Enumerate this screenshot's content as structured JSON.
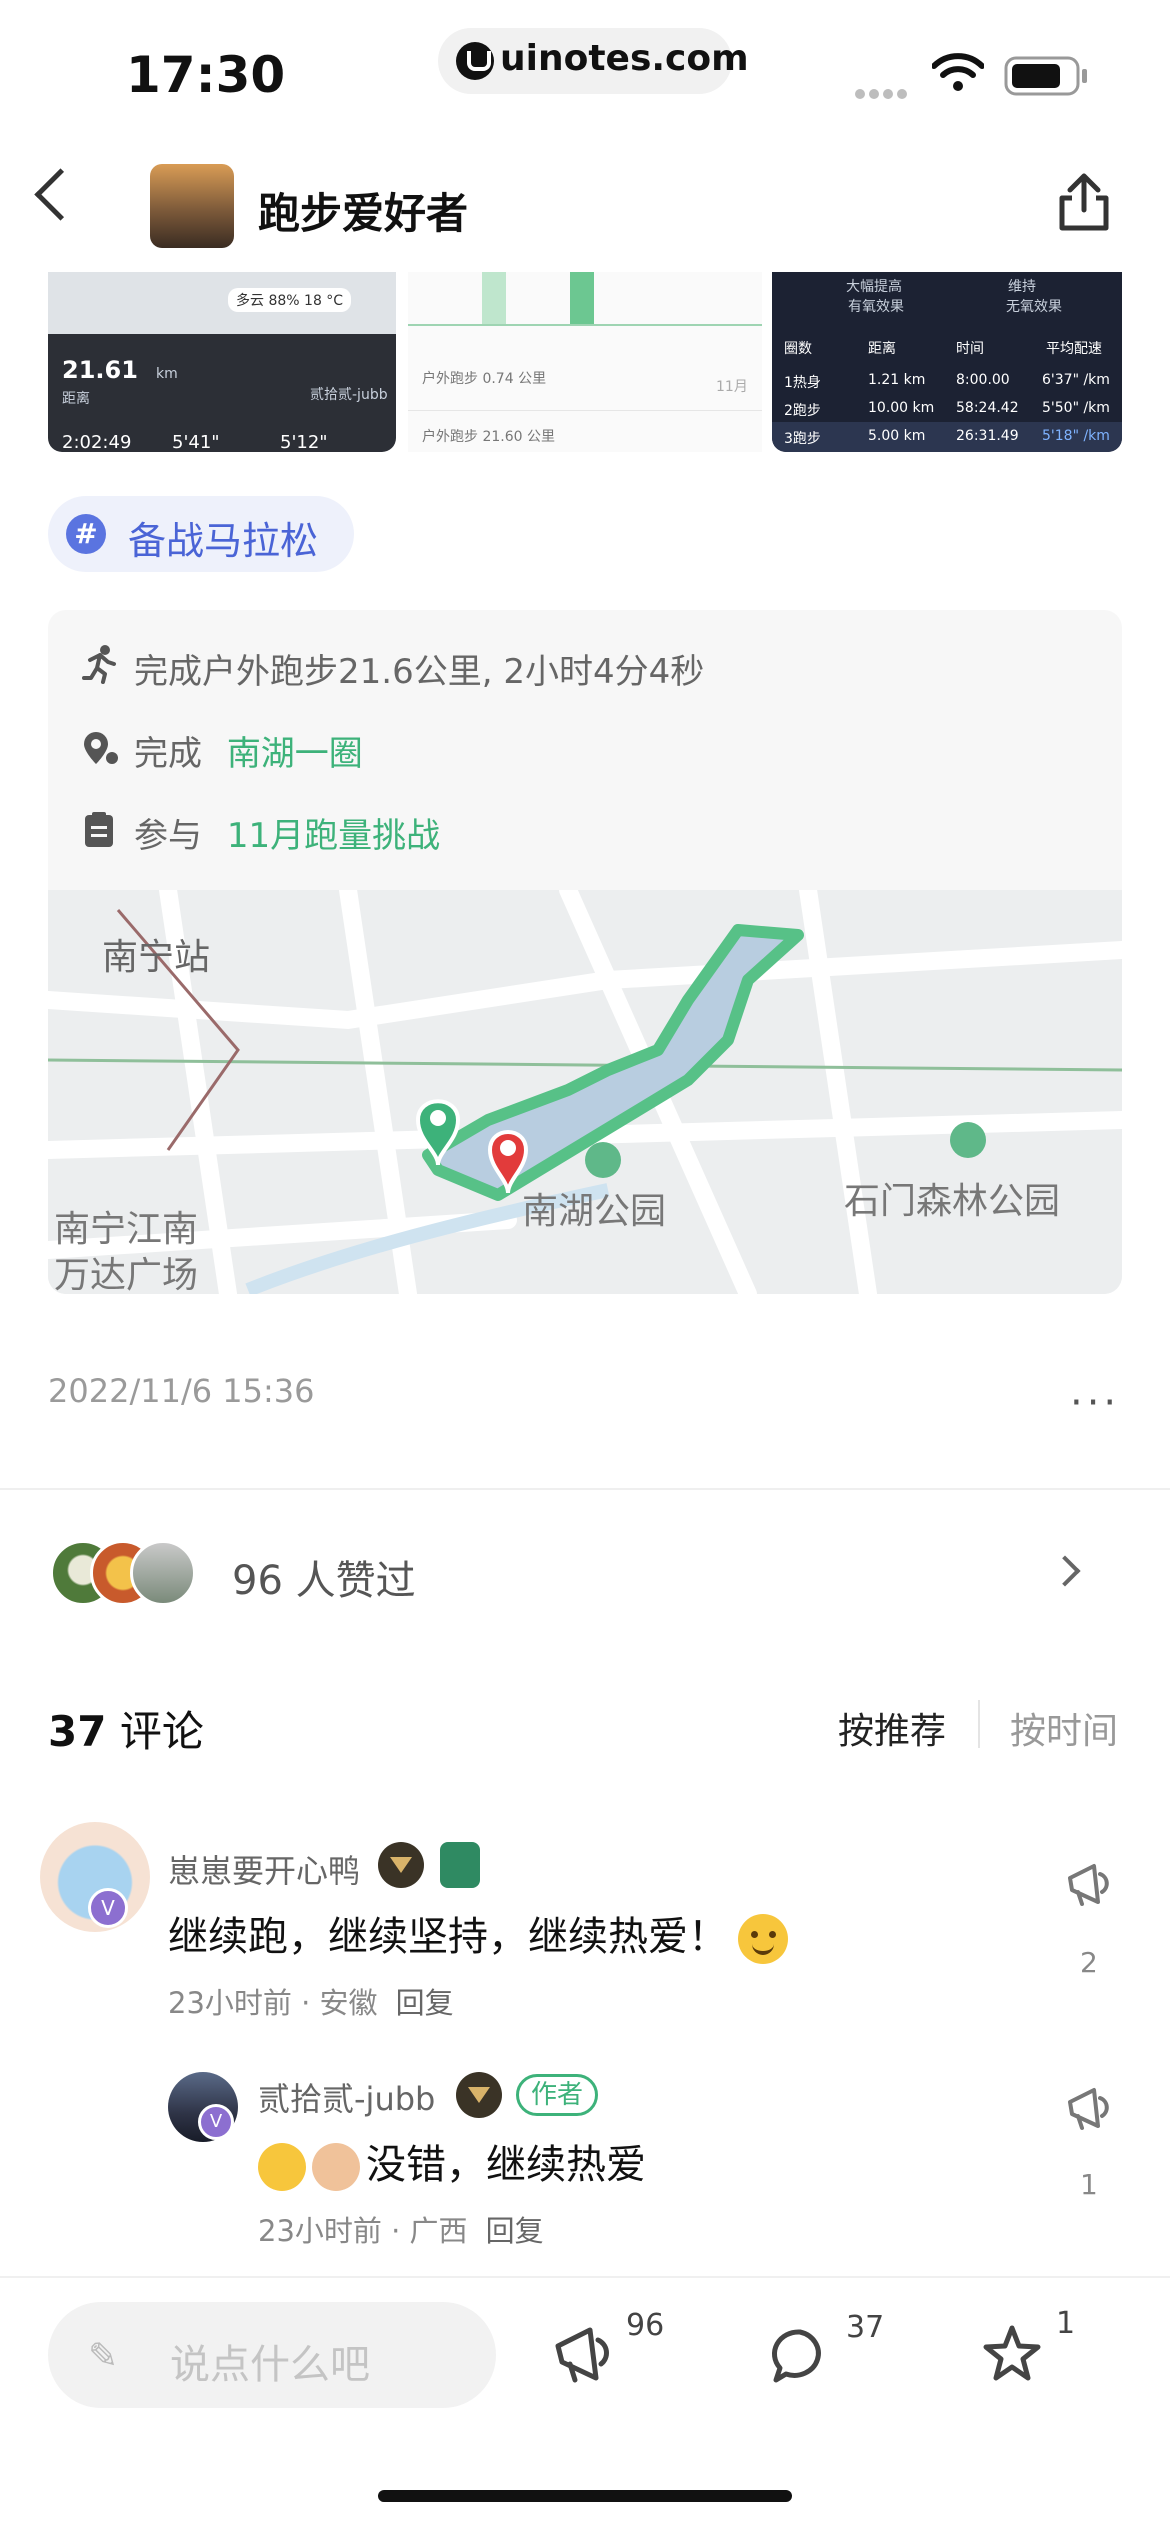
{
  "status_bar": {
    "time": "17:30",
    "url": "uinotes.com"
  },
  "nav": {
    "title": "跑步爱好者"
  },
  "thumbs": {
    "thumb1": {
      "weather": "多云",
      "humidity": "88%",
      "temp": "18 °C",
      "distance": "21.61",
      "distance_unit": "km",
      "distance_label": "距离",
      "user": "贰拾贰-jubb",
      "duration": "2:02:49",
      "pace1": "5'41\"",
      "pace2": "5'12\""
    },
    "thumb2": {
      "row1": "户外跑步 0.74 公里",
      "row2": "户外跑步 21.60 公里",
      "date": "11月"
    },
    "thumb3": {
      "headers": [
        "圈数",
        "距离",
        "时间",
        "平均配速"
      ],
      "rows": [
        [
          "1热身",
          "1.21 km",
          "8:00.00",
          "6'37\" /km"
        ],
        [
          "2跑步",
          "10.00 km",
          "58:24.42",
          "5'50\" /km"
        ],
        [
          "3跑步",
          "5.00 km",
          "26:31.49",
          "5'18\" /km"
        ]
      ],
      "top_labels": [
        "大幅提高",
        "维持",
        "有氧效果",
        "无氧效果"
      ]
    }
  },
  "topic": {
    "hash": "#",
    "label": "备战马拉松"
  },
  "activity": {
    "run_text": "完成户外跑步21.6公里, 2小时4分4秒",
    "route_prefix": "完成",
    "route_link": "南湖一圈",
    "challenge_prefix": "参与",
    "challenge_link": "11月跑量挑战"
  },
  "map": {
    "labels": {
      "station": "南宁站",
      "park1": "南湖公园",
      "park2": "石门森林公园",
      "plaza_line1": "南宁江南",
      "plaza_line2": "万达广场"
    }
  },
  "post": {
    "date": "2022/11/6 15:36",
    "more": "···"
  },
  "likes": {
    "count_text": "96  人赞过"
  },
  "comments_header": {
    "count": "37",
    "label": "评论",
    "sort_recommended": "按推荐",
    "sort_time": "按时间"
  },
  "comments": [
    {
      "user": "崽崽要开心鸭",
      "badge_v": "V",
      "text": "继续跑，继续坚持，继续热爱！",
      "time": "23小时前 · 安徽",
      "reply": "回复",
      "likes": "2"
    },
    {
      "user": "贰拾贰-jubb",
      "badge_v": "V",
      "author_tag": "作者",
      "text": "没错，继续热爱",
      "time": "23小时前 · 广西",
      "reply": "回复",
      "likes": "1"
    }
  ],
  "bottom_bar": {
    "placeholder": "说点什么吧",
    "like_count": "96",
    "comment_count": "37",
    "star_count": "1"
  },
  "colors": {
    "accent_green": "#3db27a",
    "topic_blue": "#4a64d6"
  }
}
